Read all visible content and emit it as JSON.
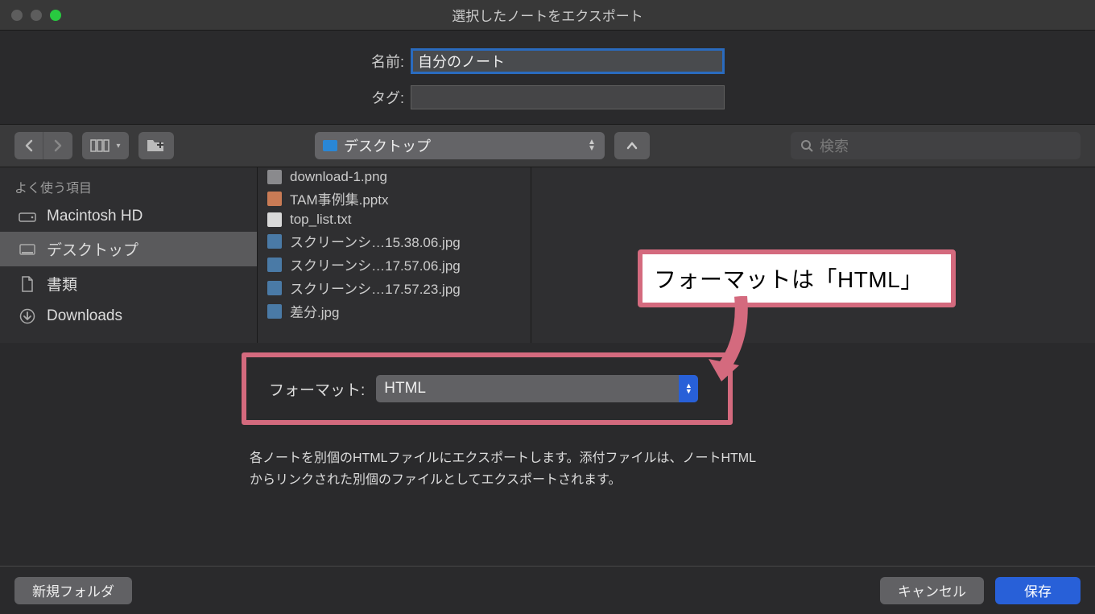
{
  "window": {
    "title": "選択したノートをエクスポート"
  },
  "meta": {
    "name_label": "名前:",
    "name_value": "自分のノート",
    "tag_label": "タグ:",
    "tag_value": ""
  },
  "toolbar": {
    "location": "デスクトップ",
    "search_placeholder": "検索"
  },
  "sidebar": {
    "header": "よく使う項目",
    "items": [
      {
        "label": "Macintosh HD",
        "icon": "hdd-icon"
      },
      {
        "label": "デスクトップ",
        "icon": "desktop-icon",
        "selected": true
      },
      {
        "label": "書類",
        "icon": "document-icon"
      },
      {
        "label": "Downloads",
        "icon": "download-icon"
      }
    ]
  },
  "files": [
    {
      "name": "download-1.png",
      "kind": "png"
    },
    {
      "name": "TAM事例集.pptx",
      "kind": "pptx"
    },
    {
      "name": "top_list.txt",
      "kind": "txt"
    },
    {
      "name": "スクリーンシ…15.38.06.jpg",
      "kind": "jpg"
    },
    {
      "name": "スクリーンシ…17.57.06.jpg",
      "kind": "jpg"
    },
    {
      "name": "スクリーンシ…17.57.23.jpg",
      "kind": "jpg"
    },
    {
      "name": "差分.jpg",
      "kind": "jpg"
    }
  ],
  "format": {
    "label": "フォーマット:",
    "value": "HTML"
  },
  "callout": {
    "text": "フォーマットは「HTML」"
  },
  "description": "各ノートを別個のHTMLファイルにエクスポートします。添付ファイルは、ノートHTMLからリンクされた別個のファイルとしてエクスポートされます。",
  "footer": {
    "new_folder": "新規フォルダ",
    "cancel": "キャンセル",
    "save": "保存"
  }
}
